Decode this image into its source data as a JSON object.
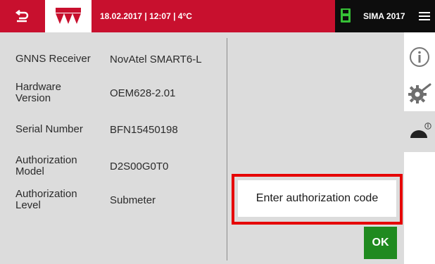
{
  "header": {
    "status": "18.02.2017 | 12:07 | 4°C",
    "brand": "SIMA 2017",
    "colors": {
      "accent_red": "#c8102e",
      "dark": "#0d0d0d",
      "ok_green": "#1f8a1f",
      "sd_green": "#36c036"
    }
  },
  "info": {
    "rows": [
      {
        "label": "GNNS Receiver",
        "value": "NovAtel SMART6-L"
      },
      {
        "label": "Hardware Version",
        "value": "OEM628-2.01"
      },
      {
        "label": "Serial Number",
        "value": "BFN15450198"
      },
      {
        "label": "Authorization Model",
        "value": "D2S00G0T0"
      },
      {
        "label": "Authorization Level",
        "value": "Submeter"
      }
    ]
  },
  "auth": {
    "placeholder": "Enter authorization code",
    "ok_label": "OK"
  },
  "sidebar": {
    "tabs": [
      {
        "icon": "info-icon"
      },
      {
        "icon": "settings-tool-icon"
      },
      {
        "icon": "receiver-info-icon",
        "active": true
      }
    ]
  }
}
